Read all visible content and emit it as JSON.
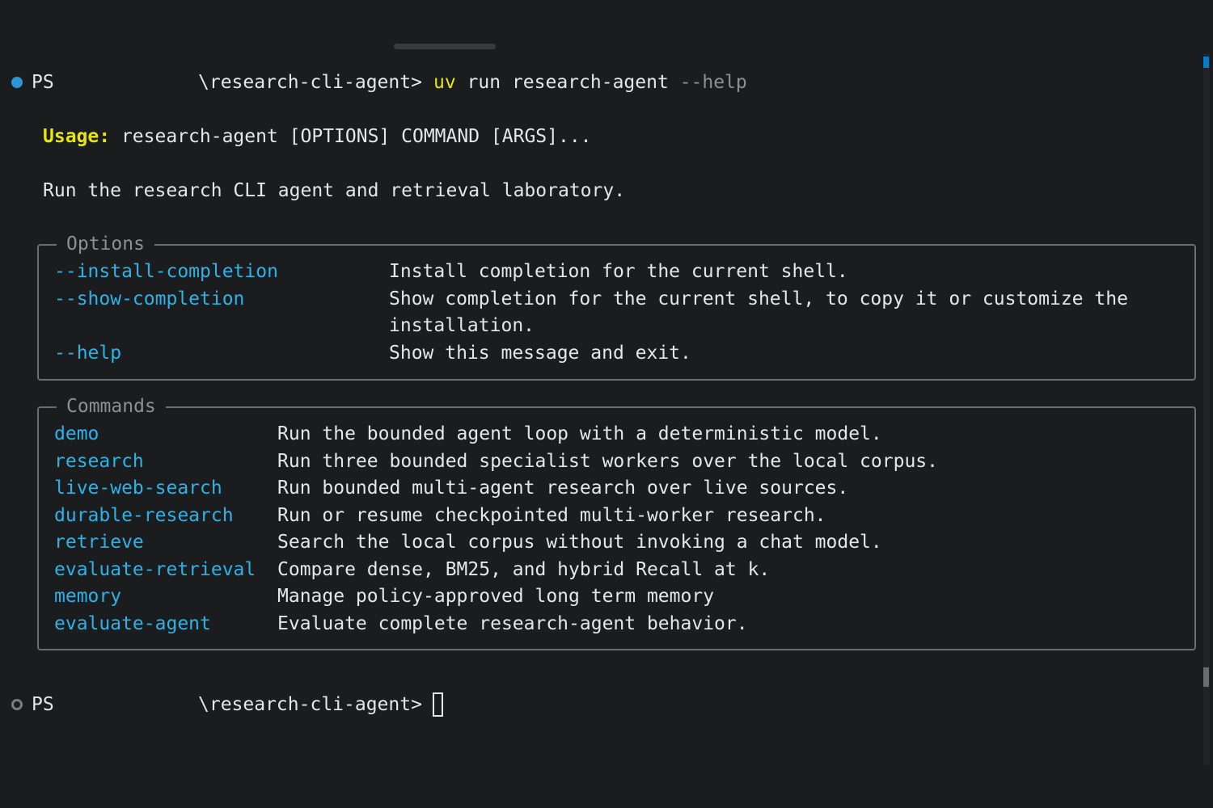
{
  "prompt": {
    "ps": "PS",
    "path": "\\research-cli-agent>",
    "command_uv": "uv",
    "command_rest": " run research-agent ",
    "command_flag": "--help"
  },
  "usage": {
    "label": "Usage:",
    "text": " research-agent [OPTIONS] COMMAND [ARGS]..."
  },
  "description": "Run the research CLI agent and retrieval laboratory.",
  "options_panel": {
    "title": "Options",
    "items": [
      {
        "name": "--install-completion",
        "desc": "Install completion for the current shell."
      },
      {
        "name": "--show-completion",
        "desc": "Show completion for the current shell, to copy it or customize the",
        "desc2": "installation."
      },
      {
        "name": "--help",
        "desc": "Show this message and exit."
      }
    ]
  },
  "commands_panel": {
    "title": "Commands",
    "items": [
      {
        "name": "demo",
        "desc": "Run the bounded agent loop with a deterministic model."
      },
      {
        "name": "research",
        "desc": "Run three bounded specialist workers over the local corpus."
      },
      {
        "name": "live-web-search",
        "desc": "Run bounded multi-agent research over live sources."
      },
      {
        "name": "durable-research",
        "desc": "Run or resume checkpointed multi-worker research."
      },
      {
        "name": "retrieve",
        "desc": "Search the local corpus without invoking a chat model."
      },
      {
        "name": "evaluate-retrieval",
        "desc": "Compare dense, BM25, and hybrid Recall at k."
      },
      {
        "name": "memory",
        "desc": "Manage policy-approved long term memory"
      },
      {
        "name": "evaluate-agent",
        "desc": "Evaluate complete research-agent behavior."
      }
    ]
  },
  "prompt2": {
    "ps": "PS",
    "path": "\\research-cli-agent>"
  },
  "colors": {
    "background": "#1b1c1e",
    "accent_blue": "#2bb3e8",
    "usage_yellow": "#e5e510",
    "status_dot_blue": "#2b95d6"
  }
}
